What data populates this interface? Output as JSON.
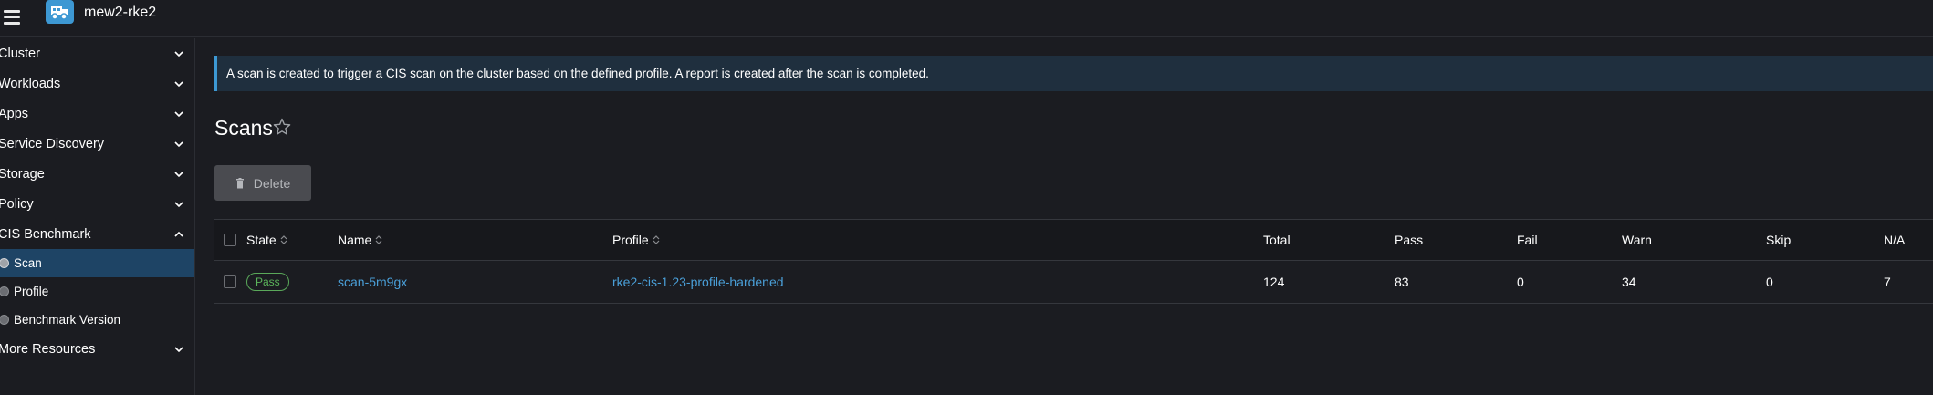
{
  "header": {
    "cluster_name": "mew2-rke2"
  },
  "sidebar": {
    "groups": [
      {
        "label": "Cluster"
      },
      {
        "label": "Workloads"
      },
      {
        "label": "Apps"
      },
      {
        "label": "Service Discovery"
      },
      {
        "label": "Storage"
      },
      {
        "label": "Policy"
      },
      {
        "label": "CIS Benchmark"
      }
    ],
    "cis_items": [
      {
        "label": "Scan",
        "active": true
      },
      {
        "label": "Profile"
      },
      {
        "label": "Benchmark Version"
      }
    ],
    "more": {
      "label": "More Resources"
    }
  },
  "banner": {
    "text": "A scan is created to trigger a CIS scan on the cluster based on the defined profile. A report is created after the scan is completed."
  },
  "page": {
    "title": "Scans",
    "delete_label": "Delete"
  },
  "table": {
    "headers": {
      "state": "State",
      "name": "Name",
      "profile": "Profile",
      "total": "Total",
      "pass": "Pass",
      "fail": "Fail",
      "warn": "Warn",
      "skip": "Skip",
      "na": "N/A"
    },
    "rows": [
      {
        "state": "Pass",
        "name": "scan-5m9gx",
        "profile": "rke2-cis-1.23-profile-hardened",
        "total": "124",
        "pass": "83",
        "fail": "0",
        "warn": "34",
        "skip": "0",
        "na": "7"
      }
    ]
  },
  "colors": {
    "accent": "#3d98d3",
    "link": "#4a9fd8",
    "pass_badge": "#5bb55b",
    "active_nav": "#1e4465"
  }
}
